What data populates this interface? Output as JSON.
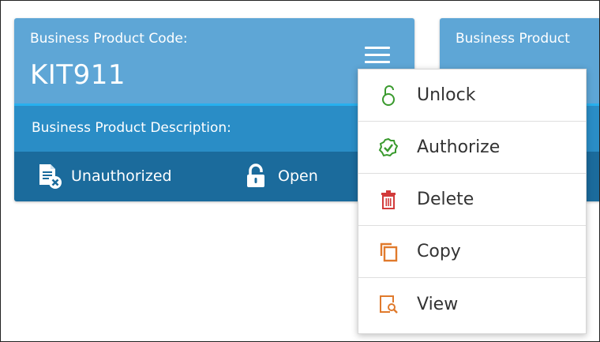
{
  "tiles": [
    {
      "code_label": "Business Product Code:",
      "code_value": "KIT911",
      "description_label": "Business Product Description:",
      "status_authorization": "Unauthorized",
      "status_lock": "Open"
    },
    {
      "code_label": "Business Product",
      "code_value": "",
      "description_label": "",
      "status_authorization": "",
      "status_lock": ""
    }
  ],
  "menu": {
    "items": [
      {
        "label": "Unlock",
        "icon": "unlock-icon",
        "color": "#3a9a2e"
      },
      {
        "label": "Authorize",
        "icon": "authorize-check-icon",
        "color": "#3a9a2e"
      },
      {
        "label": "Delete",
        "icon": "trash-icon",
        "color": "#d23a3a"
      },
      {
        "label": "Copy",
        "icon": "copy-icon",
        "color": "#e07a2c"
      },
      {
        "label": "View",
        "icon": "view-document-icon",
        "color": "#e07a2c"
      }
    ]
  },
  "colors": {
    "tile_header": "#5ea6d6",
    "tile_description": "#2a8dc6",
    "tile_footer": "#1b6b9c",
    "accent_line": "#28b0ee"
  }
}
